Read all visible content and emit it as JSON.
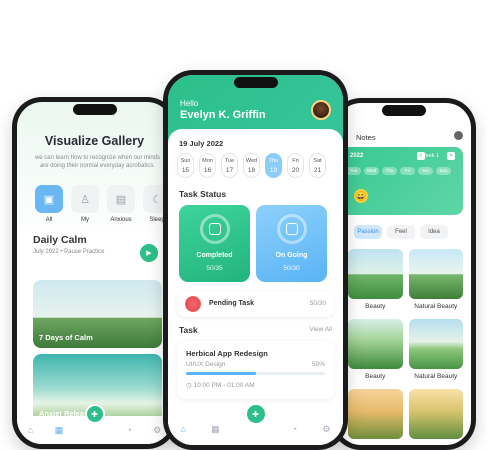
{
  "gallery": {
    "title": "Visualize Gallery",
    "description": "we can learn how to recognize when our minds are doing their normal everyday acrobatics.",
    "categories": [
      {
        "label": "All",
        "icon": "all-icon"
      },
      {
        "label": "My",
        "icon": "user-icon"
      },
      {
        "label": "Anxious",
        "icon": "anxious-icon"
      },
      {
        "label": "Sleep",
        "icon": "moon-icon"
      }
    ],
    "daily_calm": {
      "title": "Daily Calm",
      "subtitle": "July 2022 • Pause Practice"
    },
    "cards": [
      {
        "caption": "7 Days of Calm"
      },
      {
        "caption": "Anxiet Relea"
      }
    ]
  },
  "planner": {
    "greeting": "Hello",
    "user_name": "Evelyn K. Griffin",
    "date": "19 July 2022",
    "days": [
      {
        "day": "Sun",
        "num": "15"
      },
      {
        "day": "Mon",
        "num": "16"
      },
      {
        "day": "Tue",
        "num": "17"
      },
      {
        "day": "Wed",
        "num": "18"
      },
      {
        "day": "Thu",
        "num": "19"
      },
      {
        "day": "Fri",
        "num": "20"
      },
      {
        "day": "Sat",
        "num": "21"
      }
    ],
    "selected_day_index": 4,
    "task_status_title": "Task Status",
    "completed": {
      "label": "Completed",
      "count": "50/35"
    },
    "ongoing": {
      "label": "On Going",
      "count": "50/30"
    },
    "pending": {
      "label": "Pending Task",
      "count": "50/30"
    },
    "task_title": "Task",
    "view_all": "View All",
    "task_card": {
      "name": "Herbical App Redesign",
      "category": "UI/UX Design",
      "percent": "50%",
      "progress": 0.5,
      "time": "10:00 PM - 01:00 AM"
    }
  },
  "notes": {
    "title": "Notes",
    "banner_date": "2022",
    "week": "Week 1",
    "week_prev": "<",
    "week_next": ">",
    "days": [
      "Tue",
      "Wed",
      "Thu",
      "Fri",
      "Sat",
      "Sun"
    ],
    "emoji": "😀",
    "tabs": [
      "Passion",
      "Feel",
      "Idea"
    ],
    "active_tab_index": 0,
    "items": [
      "Beauty",
      "Natural Beauty",
      "Beauty",
      "Natural Beauty",
      "",
      ""
    ]
  },
  "colors": {
    "brand_green": "#2cbf8a",
    "accent_blue": "#5ab4f5"
  }
}
